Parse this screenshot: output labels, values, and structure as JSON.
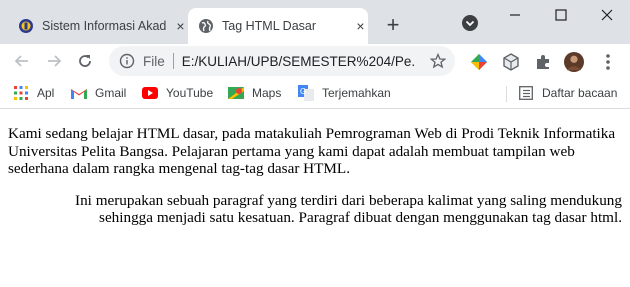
{
  "tabs": [
    {
      "title": "Sistem Informasi Akad",
      "close": "×"
    },
    {
      "title": "Tag HTML Dasar",
      "close": "×"
    }
  ],
  "new_tab": "+",
  "address_bar": {
    "scheme_label": "File",
    "url": "E:/KULIAH/UPB/SEMESTER%204/Pe..."
  },
  "bookmarks": [
    {
      "label": "Apl",
      "icon": "apps-grid-icon"
    },
    {
      "label": "Gmail",
      "icon": "gmail-icon"
    },
    {
      "label": "YouTube",
      "icon": "youtube-icon"
    },
    {
      "label": "Maps",
      "icon": "maps-icon"
    },
    {
      "label": "Terjemahkan",
      "icon": "translate-icon"
    }
  ],
  "reading_list": "Daftar bacaan",
  "content": {
    "paragraph_1": "Kami sedang belajar HTML dasar, pada matakuliah Pemrograman Web di Prodi Teknik Informatika Universitas Pelita Bangsa. Pelajaran pertama yang kami dapat adalah membuat tampilan web sederhana dalam rangka mengenal tag-tag dasar HTML.",
    "paragraph_2": "Ini merupakan sebuah paragraf yang terdiri dari beberapa kalimat yang saling mendukung sehingga menjadi satu kesatuan. Paragraf dibuat dengan menggunakan tag dasar html."
  }
}
